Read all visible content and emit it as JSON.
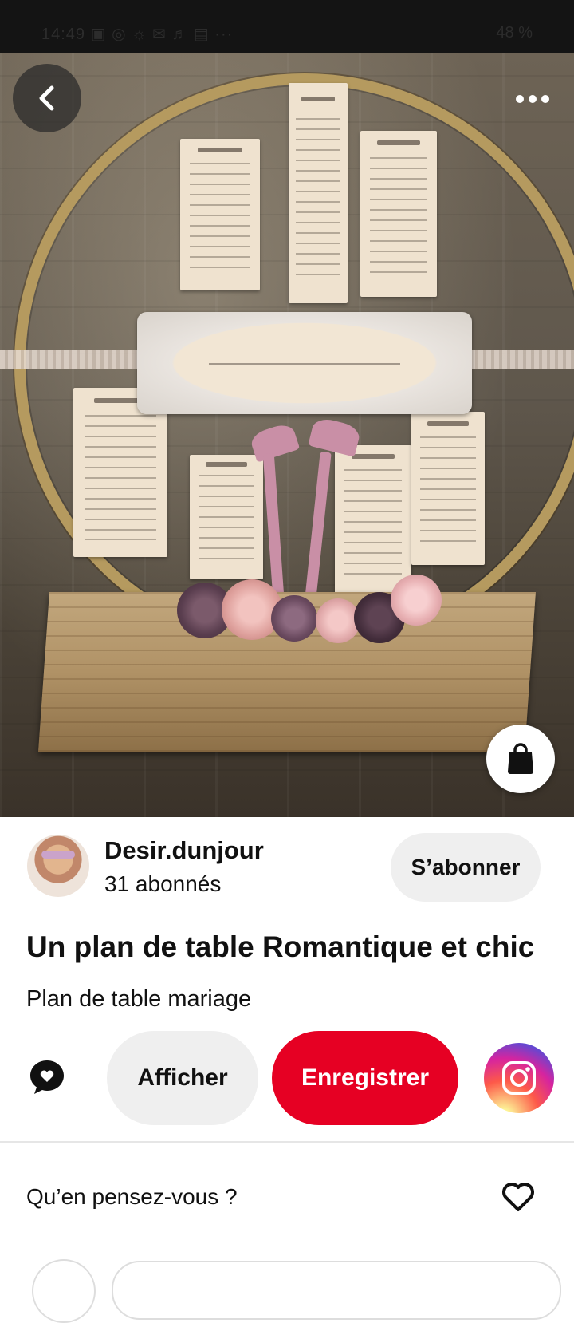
{
  "status_bar": {
    "time": "14:49",
    "left_icons": "▣ ◎ ☼ ✉ ♬ ▤ ···",
    "right_text": "48 %"
  },
  "hero": {
    "back_icon": "chevron-left-icon",
    "more_icon": "more-dots-icon",
    "bag_icon": "shopping-bag-icon"
  },
  "creator": {
    "name": "Desir.dunjour",
    "followers": "31 abonnés",
    "follow_label": "S’abonner"
  },
  "pin": {
    "title": "Un plan de table Romantique et chic",
    "description": "Plan de table mariage"
  },
  "actions": {
    "view_label": "Afficher",
    "save_label": "Enregistrer",
    "save_color": "#e60023",
    "comment_icon": "comment-icon",
    "share_icon": "instagram-icon"
  },
  "comments": {
    "prompt": "Qu’en pensez-vous ?",
    "like_icon": "heart-icon"
  }
}
